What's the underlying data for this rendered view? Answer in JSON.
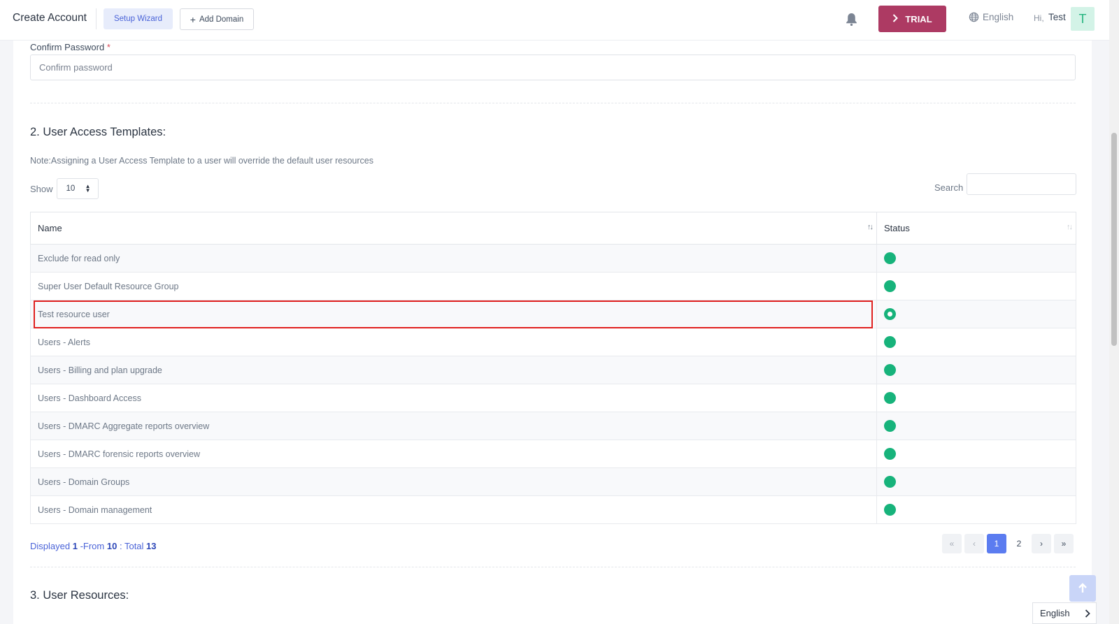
{
  "header": {
    "title": "Create Account",
    "setup_wizard": "Setup Wizard",
    "add_domain": "Add Domain",
    "trial": "TRIAL",
    "language": "English",
    "greeting": "Hi,",
    "user_name": "Test",
    "avatar_letter": "T"
  },
  "confirm_password": {
    "label": "Confirm Password",
    "required_mark": "*",
    "placeholder": "Confirm password"
  },
  "section2": {
    "title": "2. User Access Templates:",
    "note": "Note:Assigning a User Access Template to a user will override the default user resources",
    "show_label": "Show",
    "show_value": "10",
    "search_label": "Search",
    "columns": [
      "Name",
      "Status"
    ],
    "rows": [
      {
        "name": "Exclude for read only",
        "status": "active"
      },
      {
        "name": "Super User Default Resource Group",
        "status": "active"
      },
      {
        "name": "Test resource user",
        "status": "selected"
      },
      {
        "name": "Users - Alerts",
        "status": "active"
      },
      {
        "name": "Users - Billing and plan upgrade",
        "status": "active"
      },
      {
        "name": "Users - Dashboard Access",
        "status": "active"
      },
      {
        "name": "Users - DMARC Aggregate reports overview",
        "status": "active"
      },
      {
        "name": "Users - DMARC forensic reports overview",
        "status": "active"
      },
      {
        "name": "Users - Domain Groups",
        "status": "active"
      },
      {
        "name": "Users - Domain management",
        "status": "active"
      }
    ],
    "footer": {
      "displayed": "Displayed",
      "from_num": "1",
      "from_text": "-From",
      "to_num": "10",
      "total_text": ": Total",
      "total_num": "13"
    },
    "pagination": {
      "pages": [
        "1",
        "2"
      ],
      "current": "1"
    }
  },
  "section3": {
    "title": "3. User Resources:"
  },
  "footer_language": "English",
  "colors": {
    "accent": "#5b7cf0",
    "trial": "#ad3a63",
    "status_green": "#17b37b",
    "highlight": "#e0201f"
  }
}
